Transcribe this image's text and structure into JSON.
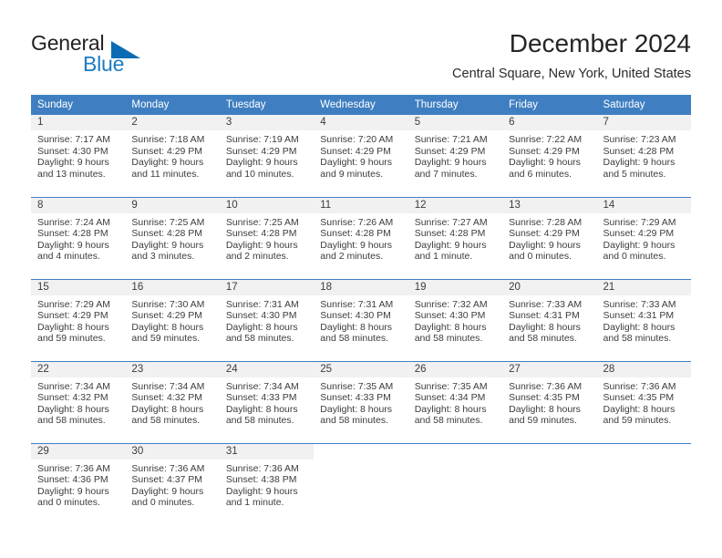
{
  "brand": {
    "name_top": "General",
    "name_bottom": "Blue",
    "triangle_color": "#0b6cb3",
    "blue_color": "#1b7bc4"
  },
  "header": {
    "title": "December 2024",
    "location": "Central Square, New York, United States"
  },
  "theme": {
    "header_bg": "#3f7fc1",
    "header_text": "#ffffff",
    "row_shade": "#f1f1f1",
    "grid_line": "#3f7fc1",
    "text": "#3c3c3c"
  },
  "weekday_headers": [
    "Sunday",
    "Monday",
    "Tuesday",
    "Wednesday",
    "Thursday",
    "Friday",
    "Saturday"
  ],
  "weeks": [
    [
      {
        "day": "1",
        "sunrise": "Sunrise: 7:17 AM",
        "sunset": "Sunset: 4:30 PM",
        "daylight_1": "Daylight: 9 hours",
        "daylight_2": "and 13 minutes."
      },
      {
        "day": "2",
        "sunrise": "Sunrise: 7:18 AM",
        "sunset": "Sunset: 4:29 PM",
        "daylight_1": "Daylight: 9 hours",
        "daylight_2": "and 11 minutes."
      },
      {
        "day": "3",
        "sunrise": "Sunrise: 7:19 AM",
        "sunset": "Sunset: 4:29 PM",
        "daylight_1": "Daylight: 9 hours",
        "daylight_2": "and 10 minutes."
      },
      {
        "day": "4",
        "sunrise": "Sunrise: 7:20 AM",
        "sunset": "Sunset: 4:29 PM",
        "daylight_1": "Daylight: 9 hours",
        "daylight_2": "and 9 minutes."
      },
      {
        "day": "5",
        "sunrise": "Sunrise: 7:21 AM",
        "sunset": "Sunset: 4:29 PM",
        "daylight_1": "Daylight: 9 hours",
        "daylight_2": "and 7 minutes."
      },
      {
        "day": "6",
        "sunrise": "Sunrise: 7:22 AM",
        "sunset": "Sunset: 4:29 PM",
        "daylight_1": "Daylight: 9 hours",
        "daylight_2": "and 6 minutes."
      },
      {
        "day": "7",
        "sunrise": "Sunrise: 7:23 AM",
        "sunset": "Sunset: 4:28 PM",
        "daylight_1": "Daylight: 9 hours",
        "daylight_2": "and 5 minutes."
      }
    ],
    [
      {
        "day": "8",
        "sunrise": "Sunrise: 7:24 AM",
        "sunset": "Sunset: 4:28 PM",
        "daylight_1": "Daylight: 9 hours",
        "daylight_2": "and 4 minutes."
      },
      {
        "day": "9",
        "sunrise": "Sunrise: 7:25 AM",
        "sunset": "Sunset: 4:28 PM",
        "daylight_1": "Daylight: 9 hours",
        "daylight_2": "and 3 minutes."
      },
      {
        "day": "10",
        "sunrise": "Sunrise: 7:25 AM",
        "sunset": "Sunset: 4:28 PM",
        "daylight_1": "Daylight: 9 hours",
        "daylight_2": "and 2 minutes."
      },
      {
        "day": "11",
        "sunrise": "Sunrise: 7:26 AM",
        "sunset": "Sunset: 4:28 PM",
        "daylight_1": "Daylight: 9 hours",
        "daylight_2": "and 2 minutes."
      },
      {
        "day": "12",
        "sunrise": "Sunrise: 7:27 AM",
        "sunset": "Sunset: 4:28 PM",
        "daylight_1": "Daylight: 9 hours",
        "daylight_2": "and 1 minute."
      },
      {
        "day": "13",
        "sunrise": "Sunrise: 7:28 AM",
        "sunset": "Sunset: 4:29 PM",
        "daylight_1": "Daylight: 9 hours",
        "daylight_2": "and 0 minutes."
      },
      {
        "day": "14",
        "sunrise": "Sunrise: 7:29 AM",
        "sunset": "Sunset: 4:29 PM",
        "daylight_1": "Daylight: 9 hours",
        "daylight_2": "and 0 minutes."
      }
    ],
    [
      {
        "day": "15",
        "sunrise": "Sunrise: 7:29 AM",
        "sunset": "Sunset: 4:29 PM",
        "daylight_1": "Daylight: 8 hours",
        "daylight_2": "and 59 minutes."
      },
      {
        "day": "16",
        "sunrise": "Sunrise: 7:30 AM",
        "sunset": "Sunset: 4:29 PM",
        "daylight_1": "Daylight: 8 hours",
        "daylight_2": "and 59 minutes."
      },
      {
        "day": "17",
        "sunrise": "Sunrise: 7:31 AM",
        "sunset": "Sunset: 4:30 PM",
        "daylight_1": "Daylight: 8 hours",
        "daylight_2": "and 58 minutes."
      },
      {
        "day": "18",
        "sunrise": "Sunrise: 7:31 AM",
        "sunset": "Sunset: 4:30 PM",
        "daylight_1": "Daylight: 8 hours",
        "daylight_2": "and 58 minutes."
      },
      {
        "day": "19",
        "sunrise": "Sunrise: 7:32 AM",
        "sunset": "Sunset: 4:30 PM",
        "daylight_1": "Daylight: 8 hours",
        "daylight_2": "and 58 minutes."
      },
      {
        "day": "20",
        "sunrise": "Sunrise: 7:33 AM",
        "sunset": "Sunset: 4:31 PM",
        "daylight_1": "Daylight: 8 hours",
        "daylight_2": "and 58 minutes."
      },
      {
        "day": "21",
        "sunrise": "Sunrise: 7:33 AM",
        "sunset": "Sunset: 4:31 PM",
        "daylight_1": "Daylight: 8 hours",
        "daylight_2": "and 58 minutes."
      }
    ],
    [
      {
        "day": "22",
        "sunrise": "Sunrise: 7:34 AM",
        "sunset": "Sunset: 4:32 PM",
        "daylight_1": "Daylight: 8 hours",
        "daylight_2": "and 58 minutes."
      },
      {
        "day": "23",
        "sunrise": "Sunrise: 7:34 AM",
        "sunset": "Sunset: 4:32 PM",
        "daylight_1": "Daylight: 8 hours",
        "daylight_2": "and 58 minutes."
      },
      {
        "day": "24",
        "sunrise": "Sunrise: 7:34 AM",
        "sunset": "Sunset: 4:33 PM",
        "daylight_1": "Daylight: 8 hours",
        "daylight_2": "and 58 minutes."
      },
      {
        "day": "25",
        "sunrise": "Sunrise: 7:35 AM",
        "sunset": "Sunset: 4:33 PM",
        "daylight_1": "Daylight: 8 hours",
        "daylight_2": "and 58 minutes."
      },
      {
        "day": "26",
        "sunrise": "Sunrise: 7:35 AM",
        "sunset": "Sunset: 4:34 PM",
        "daylight_1": "Daylight: 8 hours",
        "daylight_2": "and 58 minutes."
      },
      {
        "day": "27",
        "sunrise": "Sunrise: 7:36 AM",
        "sunset": "Sunset: 4:35 PM",
        "daylight_1": "Daylight: 8 hours",
        "daylight_2": "and 59 minutes."
      },
      {
        "day": "28",
        "sunrise": "Sunrise: 7:36 AM",
        "sunset": "Sunset: 4:35 PM",
        "daylight_1": "Daylight: 8 hours",
        "daylight_2": "and 59 minutes."
      }
    ],
    [
      {
        "day": "29",
        "sunrise": "Sunrise: 7:36 AM",
        "sunset": "Sunset: 4:36 PM",
        "daylight_1": "Daylight: 9 hours",
        "daylight_2": "and 0 minutes."
      },
      {
        "day": "30",
        "sunrise": "Sunrise: 7:36 AM",
        "sunset": "Sunset: 4:37 PM",
        "daylight_1": "Daylight: 9 hours",
        "daylight_2": "and 0 minutes."
      },
      {
        "day": "31",
        "sunrise": "Sunrise: 7:36 AM",
        "sunset": "Sunset: 4:38 PM",
        "daylight_1": "Daylight: 9 hours",
        "daylight_2": "and 1 minute."
      },
      {
        "day": "",
        "sunrise": "",
        "sunset": "",
        "daylight_1": "",
        "daylight_2": ""
      },
      {
        "day": "",
        "sunrise": "",
        "sunset": "",
        "daylight_1": "",
        "daylight_2": ""
      },
      {
        "day": "",
        "sunrise": "",
        "sunset": "",
        "daylight_1": "",
        "daylight_2": ""
      },
      {
        "day": "",
        "sunrise": "",
        "sunset": "",
        "daylight_1": "",
        "daylight_2": ""
      }
    ]
  ]
}
